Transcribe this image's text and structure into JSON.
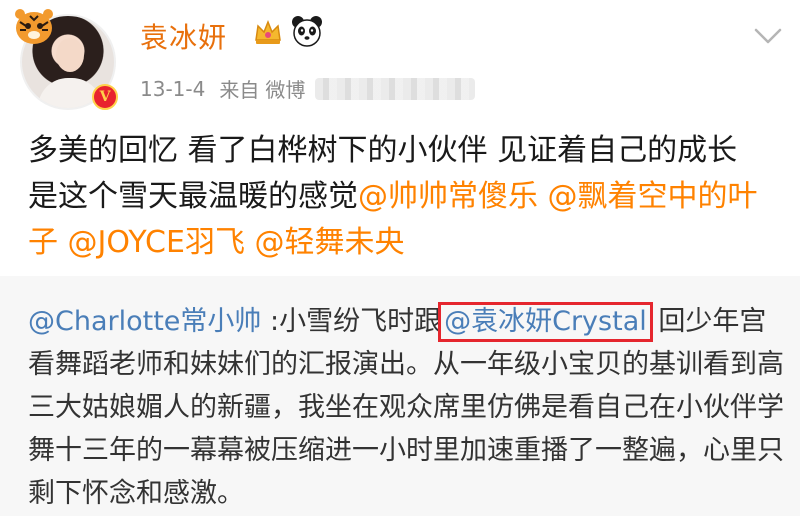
{
  "post": {
    "author_name": "袁冰妍",
    "date": "13-1-4",
    "from_label": "来自",
    "source": "微博",
    "text_1": "多美的回忆 看了白桦树下的小伙伴 见证着自己的成长 是这个雪天最温暖的感觉",
    "mentions": [
      "@帅帅常傻乐",
      "@飘着空中的叶子",
      "@JOYCE羽飞",
      "@轻舞未央"
    ]
  },
  "repost": {
    "author": "@Charlotte常小帅",
    "separator": " :",
    "text_before": "小雪纷飞时跟",
    "mention": "@袁冰妍Crystal",
    "text_after": " 回少年宫看舞蹈老师和妹妹们的汇报演出。从一年级小宝贝的基训看到高三大姑娘媚人的新疆，我坐在观众席里仿佛是看自己在小伙伴学舞十三年的一幕幕被压缩进一小时里加速重播了一整遍，心里只剩下怀念和感激。"
  },
  "icons": {
    "crown": "crown-icon",
    "panda": "panda-icon",
    "chevron": "chevron-down-icon",
    "verified": "vip-badge"
  },
  "colors": {
    "name": "#e8700c",
    "mention": "#ff8200",
    "repost_mention": "#4a7eb8",
    "repost_bg": "#f7f7f7",
    "highlight_border": "#e5262e",
    "badge_red": "#e8232e"
  }
}
